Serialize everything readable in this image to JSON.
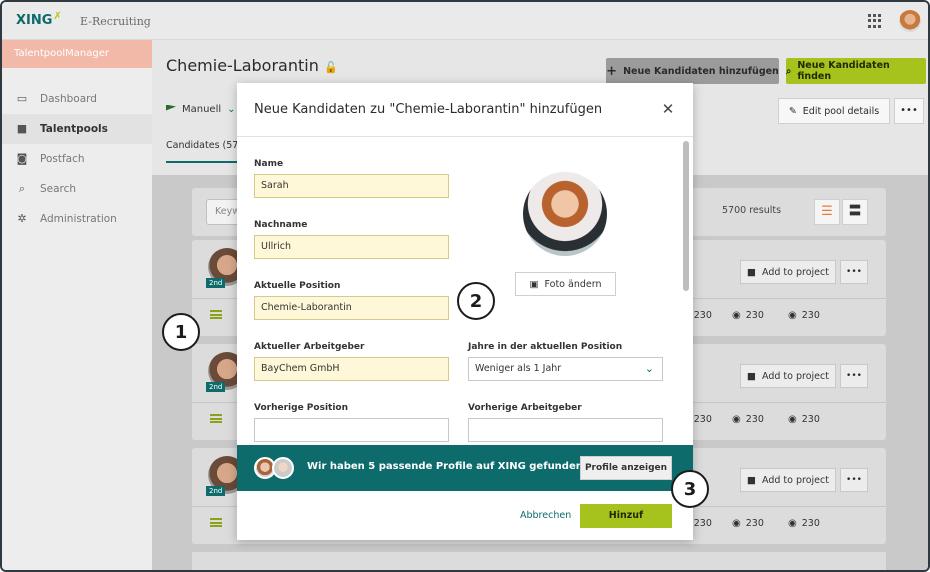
{
  "header": {
    "logo": "XING",
    "logo_sub": "E-Recruiting",
    "apps_icon": "grid-icon",
    "avatar": "user-avatar"
  },
  "sidebar": {
    "title": "TalentpoolManager",
    "items": [
      {
        "label": "Dashboard",
        "icon": "monitor-icon",
        "active": false
      },
      {
        "label": "Talentpools",
        "icon": "folder-icon",
        "active": true
      },
      {
        "label": "Postfach",
        "icon": "chat-icon",
        "active": false
      },
      {
        "label": "Search",
        "icon": "search-icon",
        "active": false
      },
      {
        "label": "Administration",
        "icon": "gear-icon",
        "active": false
      }
    ]
  },
  "main": {
    "pool_title": "Chemie-Laborantin",
    "btn_add_candidates": "Neue Kandidaten hinzufügen",
    "btn_find_candidates": "Neue Kandidaten finden",
    "manuell": "Manuell",
    "btn_edit_pool": "Edit pool details",
    "btn_more": "•••",
    "tab_candidates": "Candidates (570",
    "keyword_placeholder": "Keyw",
    "results": "5700 results",
    "cards": [
      {
        "badge": "2nd",
        "add_to_project": "Add to project",
        "more": "•••",
        "partial_stat": "30",
        "stats": [
          "230",
          "230",
          "230"
        ]
      },
      {
        "badge": "2nd",
        "add_to_project": "Add to project",
        "more": "•••",
        "partial_stat": "30",
        "stats": [
          "230",
          "230",
          "230"
        ]
      },
      {
        "badge": "2nd",
        "add_to_project": "Add to project",
        "more": "•••",
        "partial_stat": "30",
        "stats": [
          "230",
          "230",
          "230"
        ]
      }
    ]
  },
  "modal": {
    "title": "Neue Kandidaten zu \"Chemie-Laborantin\" hinzufügen",
    "close": "✕",
    "fields": {
      "name_label": "Name",
      "name_value": "Sarah",
      "nachname_label": "Nachname",
      "nachname_value": "Ullrich",
      "position_label": "Aktuelle Position",
      "position_value": "Chemie-Laborantin",
      "employer_label": "Aktueller Arbeitgeber",
      "employer_value": "BayChem GmbH",
      "years_label": "Jahre in der aktuellen Position",
      "years_value": "Weniger als 1 Jahr",
      "prev_position_label": "Vorherige Position",
      "prev_position_value": "",
      "prev_employer_label": "Vorherige Arbeitgeber",
      "prev_employer_value": ""
    },
    "foto_btn": "Foto ändern",
    "match_text": "Wir haben 5 passende Profile auf XING gefunden",
    "profile_btn": "Profile anzeigen",
    "cancel": "Abbrechen",
    "submit": "Hinzuf"
  },
  "callouts": [
    "1",
    "2",
    "3"
  ]
}
